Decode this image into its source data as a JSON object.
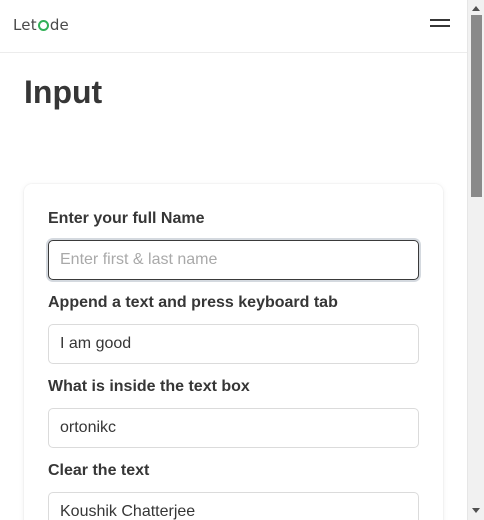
{
  "header": {
    "logo_prefix": "Let",
    "logo_mark": "+",
    "logo_suffix": "de",
    "menu_icon": "hamburger-menu-icon"
  },
  "page": {
    "title": "Input"
  },
  "form": {
    "fields": [
      {
        "label": "Enter your full Name",
        "value": "",
        "placeholder": "Enter first & last name"
      },
      {
        "label": "Append a text and press keyboard tab",
        "value": "I am good",
        "placeholder": ""
      },
      {
        "label": "What is inside the text box",
        "value": "ortonikc",
        "placeholder": ""
      },
      {
        "label": "Clear the text",
        "value": "Koushik Chatterjee",
        "placeholder": ""
      }
    ]
  },
  "colors": {
    "logo_accent": "#31b057",
    "text": "#363636",
    "focus_border": "#3a3a3a"
  }
}
